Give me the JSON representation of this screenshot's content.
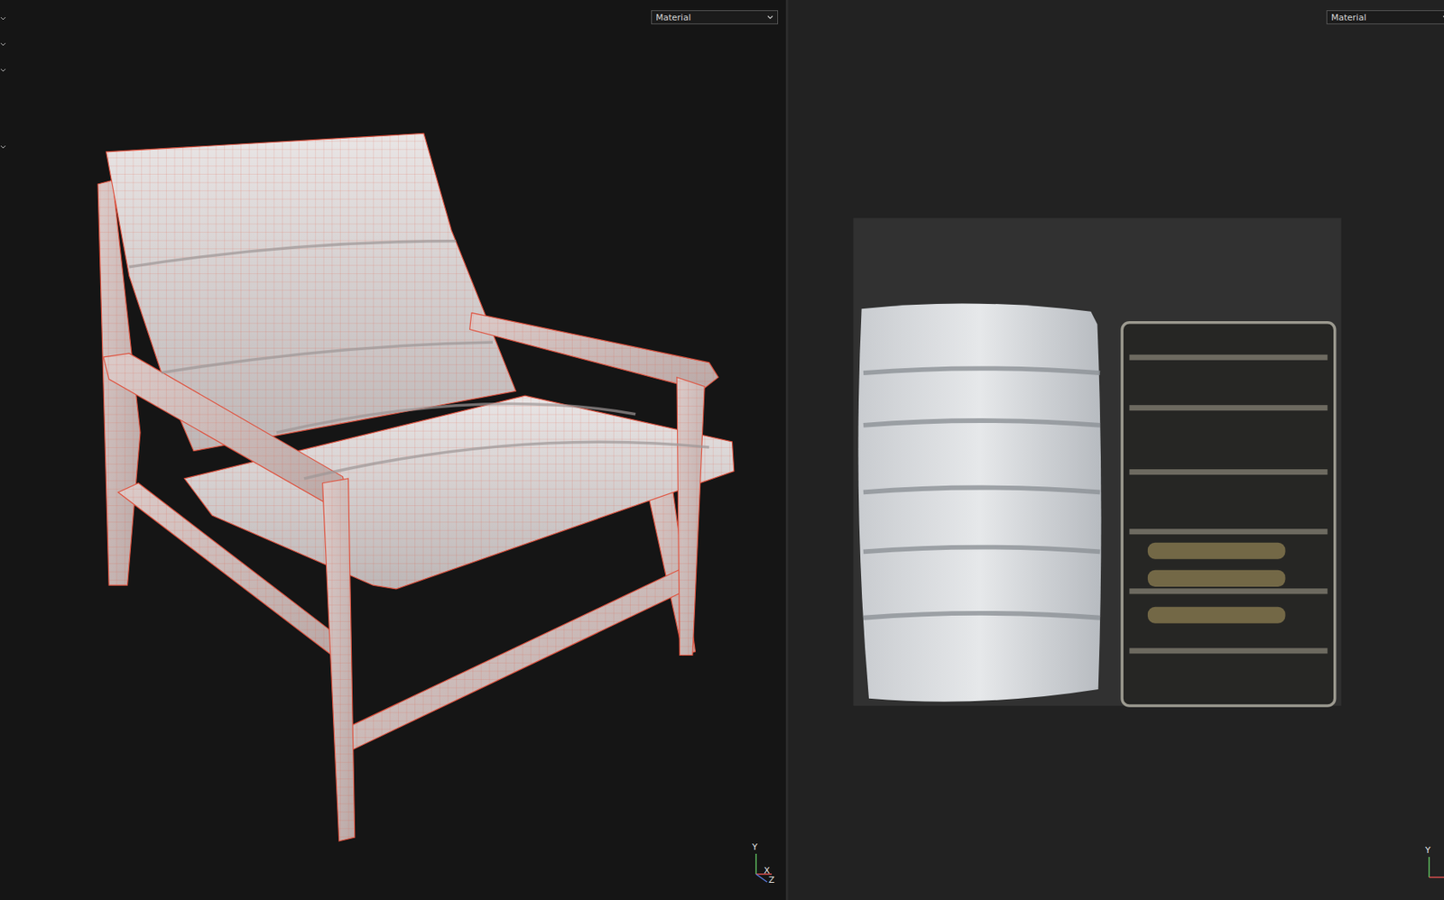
{
  "viewports": [
    {
      "dropdown": {
        "label": "Material"
      },
      "axes": [
        "Y",
        "X",
        "Z"
      ],
      "view": "3d"
    },
    {
      "dropdown": {
        "label": "Material"
      },
      "axes": [
        "Y"
      ],
      "view": "uv"
    }
  ]
}
